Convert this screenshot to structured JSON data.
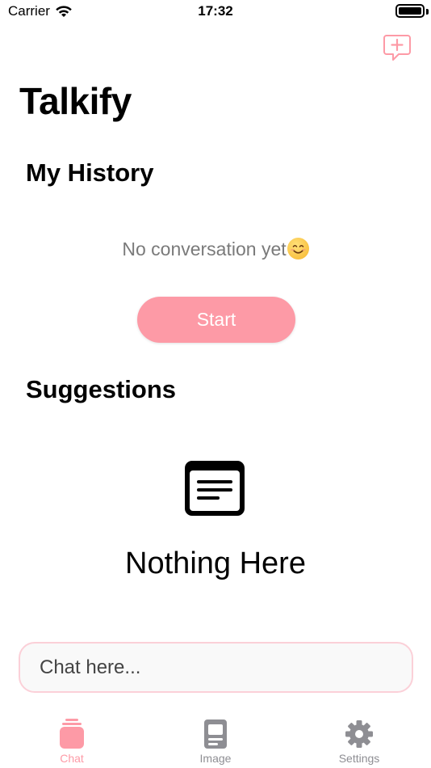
{
  "status_bar": {
    "carrier": "Carrier",
    "time": "17:32"
  },
  "header": {
    "title": "Talkify",
    "new_chat_icon": "message-plus-icon"
  },
  "history": {
    "title": "My History",
    "empty_text": "No conversation yet",
    "empty_emoji": "smiling-face-icon",
    "start_label": "Start"
  },
  "suggestions": {
    "title": "Suggestions",
    "empty_icon": "text-document-icon",
    "empty_text": "Nothing Here"
  },
  "chat_input": {
    "placeholder": "Chat here..."
  },
  "tabs": [
    {
      "label": "Chat",
      "icon": "chat-stack-icon",
      "active": true
    },
    {
      "label": "Image",
      "icon": "image-card-icon",
      "active": false
    },
    {
      "label": "Settings",
      "icon": "gear-icon",
      "active": false
    }
  ],
  "colors": {
    "accent": "#fd9aa6",
    "inactive": "#8e8e93",
    "input_border": "#fbd0d8"
  }
}
